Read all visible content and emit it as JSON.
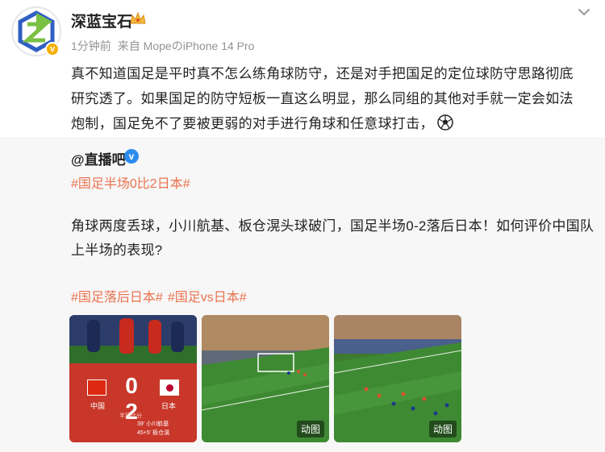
{
  "post": {
    "username": "深蓝宝石",
    "time": "1分钟前",
    "source": "来自 MopeのiPhone 14 Pro",
    "text": "真不知道国足是平时真不怎么练角球防守，还是对手把国足的定位球防守思路彻底研究透了。如果国足的防守短板一直这么明显，那么同组的其他对手就一定会如法炮制，国足免不了要被更弱的对手进行角球和任意球打击，"
  },
  "repost": {
    "source_name": "@直播吧",
    "topic": "#国足半场0比2日本#",
    "text": "角球两度丢球，小川航基、板仓滉头球破门，国足半场0-2落后日本！如何评价中国队上半场的表现?",
    "topics": [
      "#国足落后日本#",
      "#国足vs日本#"
    ]
  },
  "media": {
    "score": "0 2",
    "team_home": "中国",
    "team_away": "日本",
    "half_label": "半场比分",
    "scorers": [
      "39' 小川航基",
      "45+5' 板仓滉"
    ],
    "gif_label": "动图"
  },
  "colors": {
    "topic": "#eb7350",
    "meta": "#939393",
    "card_bg": "#f7f7f7"
  }
}
